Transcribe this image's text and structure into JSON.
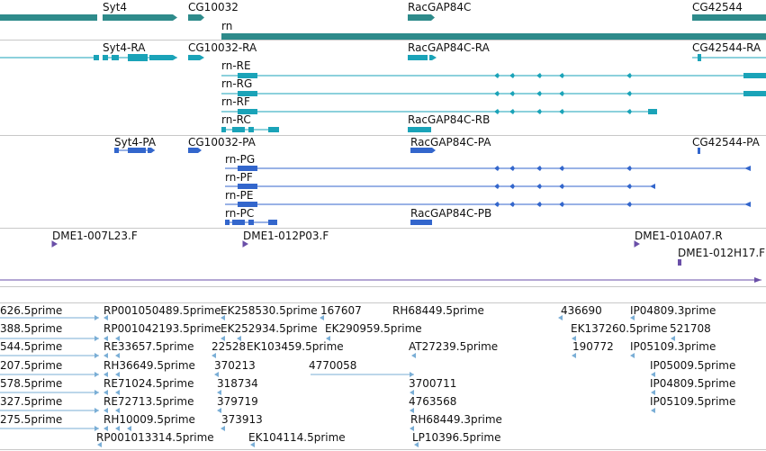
{
  "colors": {
    "gene": "#2e8b8b",
    "transcript": "#1aa3b8",
    "protein": "#3366cc",
    "clone": "#6a4fa8",
    "est": "#7aaed6",
    "border": "#c8c8c8"
  },
  "tracks": {
    "genes": {
      "labels": [
        "Syt4",
        "CG10032",
        "RacGAP84C",
        "CG42544",
        "rn"
      ]
    },
    "transcripts": {
      "labels": [
        "Syt4-RA",
        "CG10032-RA",
        "RacGAP84C-RA",
        "CG42544-RA",
        "rn-RE",
        "rn-RG",
        "rn-RF",
        "rn-RC",
        "RacGAP84C-RB"
      ]
    },
    "proteins": {
      "labels": [
        "Syt4-PA",
        "CG10032-PA",
        "RacGAP84C-PA",
        "CG42544-PA",
        "rn-PG",
        "rn-PF",
        "rn-PE",
        "rn-PC",
        "RacGAP84C-PB"
      ]
    },
    "clones": {
      "labels": [
        "DME1-007L23.F",
        "DME1-012P03.F",
        "DME1-010A07.R",
        "DME1-012H17.F"
      ]
    },
    "ests": {
      "labels": [
        "626.5prime",
        "RP001050489.5prime",
        "EK258530.5prime",
        "167607",
        "RH68449.5prime",
        "436690",
        "IP04809.3prime",
        "388.5prime",
        "RP001042193.5prime",
        "EK252934.5prime",
        "EK290959.5prime",
        "EK137260.5prime",
        "521708",
        "544.5prime",
        "RE33657.5prime",
        "22528",
        "EK103459.5prime",
        "AT27239.5prime",
        "190772",
        "IP05109.3prime",
        "207.5prime",
        "RH36649.5prime",
        "370213",
        "4770058",
        "IP05009.5prime",
        "578.5prime",
        "RE71024.5prime",
        "318734",
        "3700711",
        "IP04809.5prime",
        "327.5prime",
        "RE72713.5prime",
        "379719",
        "4763568",
        "IP05109.5prime",
        "275.5prime",
        "RH10009.5prime",
        "373913",
        "RH68449.3prime",
        "RP001013314.5prime",
        "EK104114.5prime",
        "LP10396.5prime"
      ]
    }
  }
}
